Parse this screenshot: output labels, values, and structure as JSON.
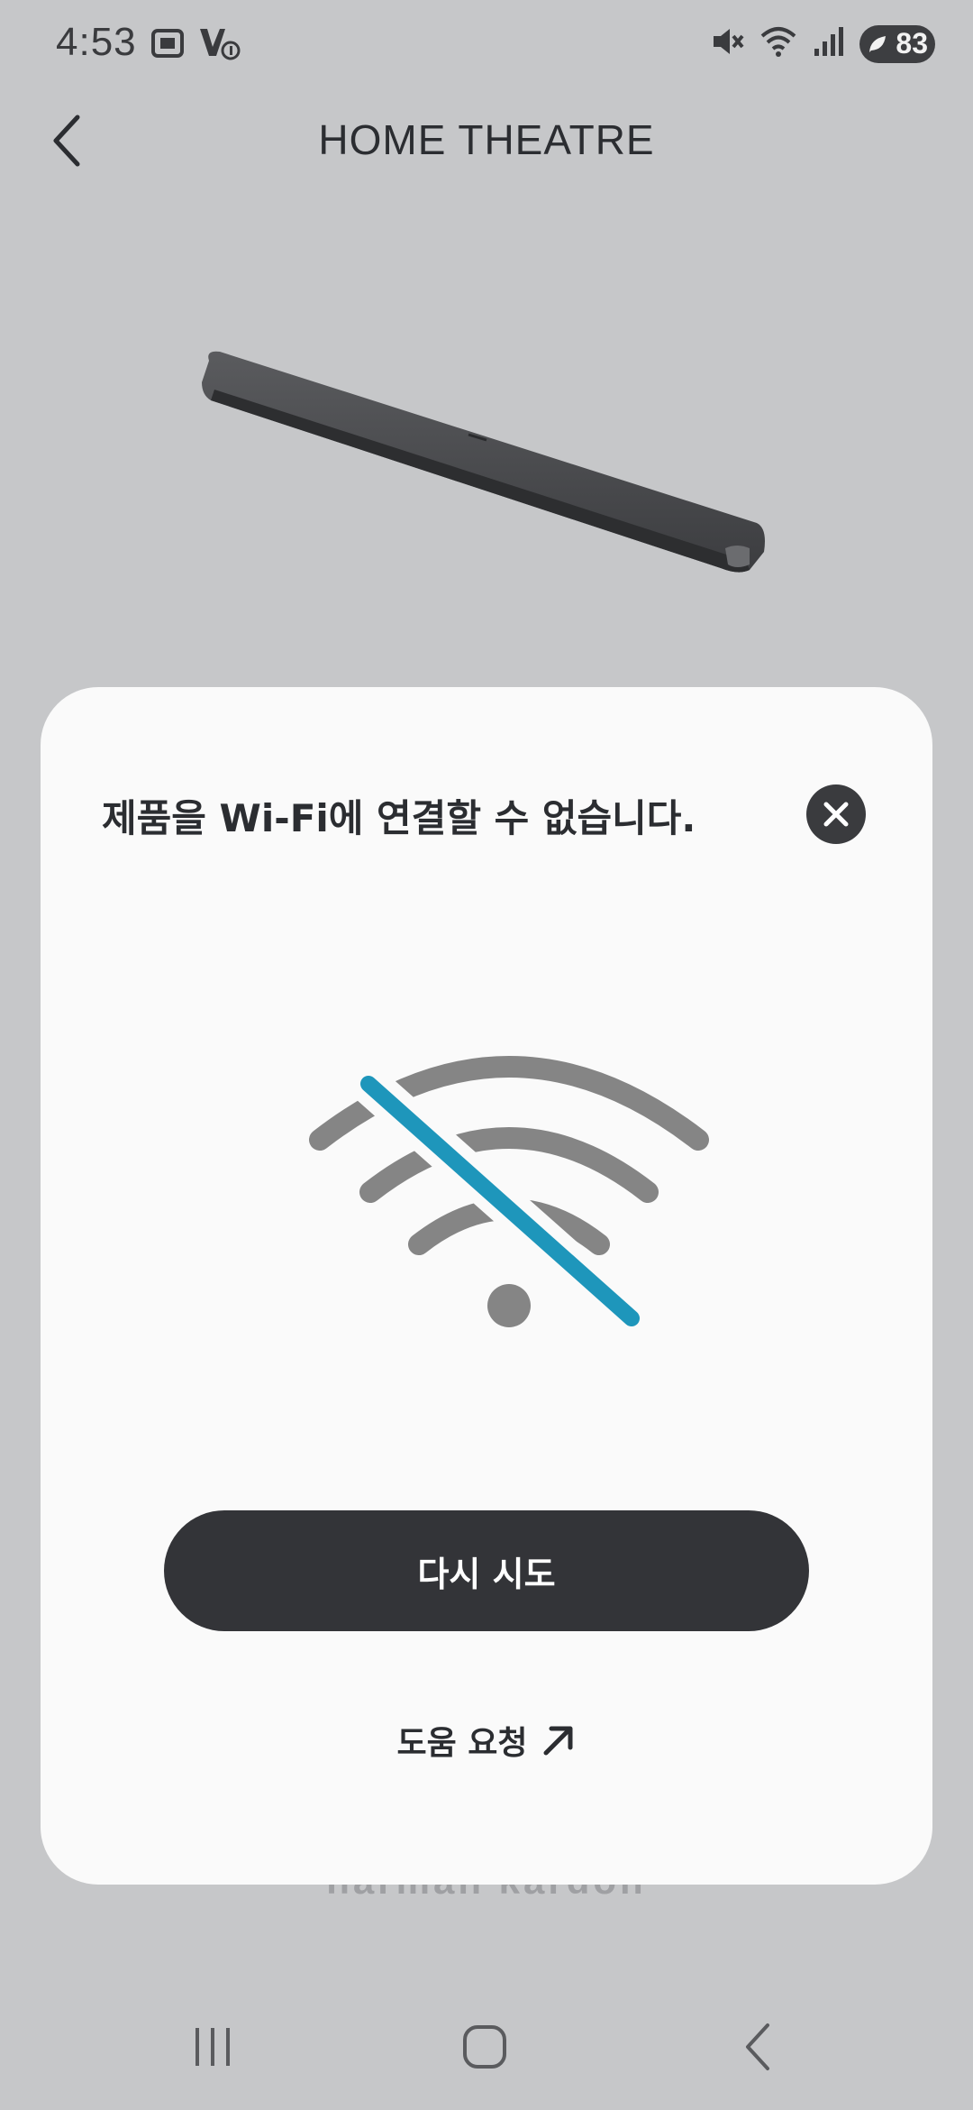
{
  "status_bar": {
    "time": "4:53",
    "battery": "83",
    "left_icons": [
      "screenshot-icon",
      "volte-icon"
    ],
    "right_icons": [
      "mute-icon",
      "wifi-icon",
      "signal-icon",
      "battery-icon"
    ]
  },
  "header": {
    "title": "HOME THEATRE",
    "back_icon": "chevron-left-icon"
  },
  "product": {
    "image": "soundbar-image"
  },
  "background": {
    "brand_partial": "harman kardon"
  },
  "dialog": {
    "title": "제품을 Wi-Fi에 연결할 수 없습니다.",
    "close_icon": "close-icon",
    "illustration": "wifi-off-icon",
    "retry_label": "다시 시도",
    "help_label": "도움 요청",
    "help_icon": "arrow-up-right-icon"
  },
  "nav_bar": {
    "items": [
      "recent-apps-icon",
      "home-icon",
      "back-icon"
    ]
  },
  "colors": {
    "backdrop": "#c6c7c9",
    "sheet": "#fafafa",
    "button": "#333438",
    "accent": "#1e96bb",
    "wifi_gray": "#858585"
  }
}
